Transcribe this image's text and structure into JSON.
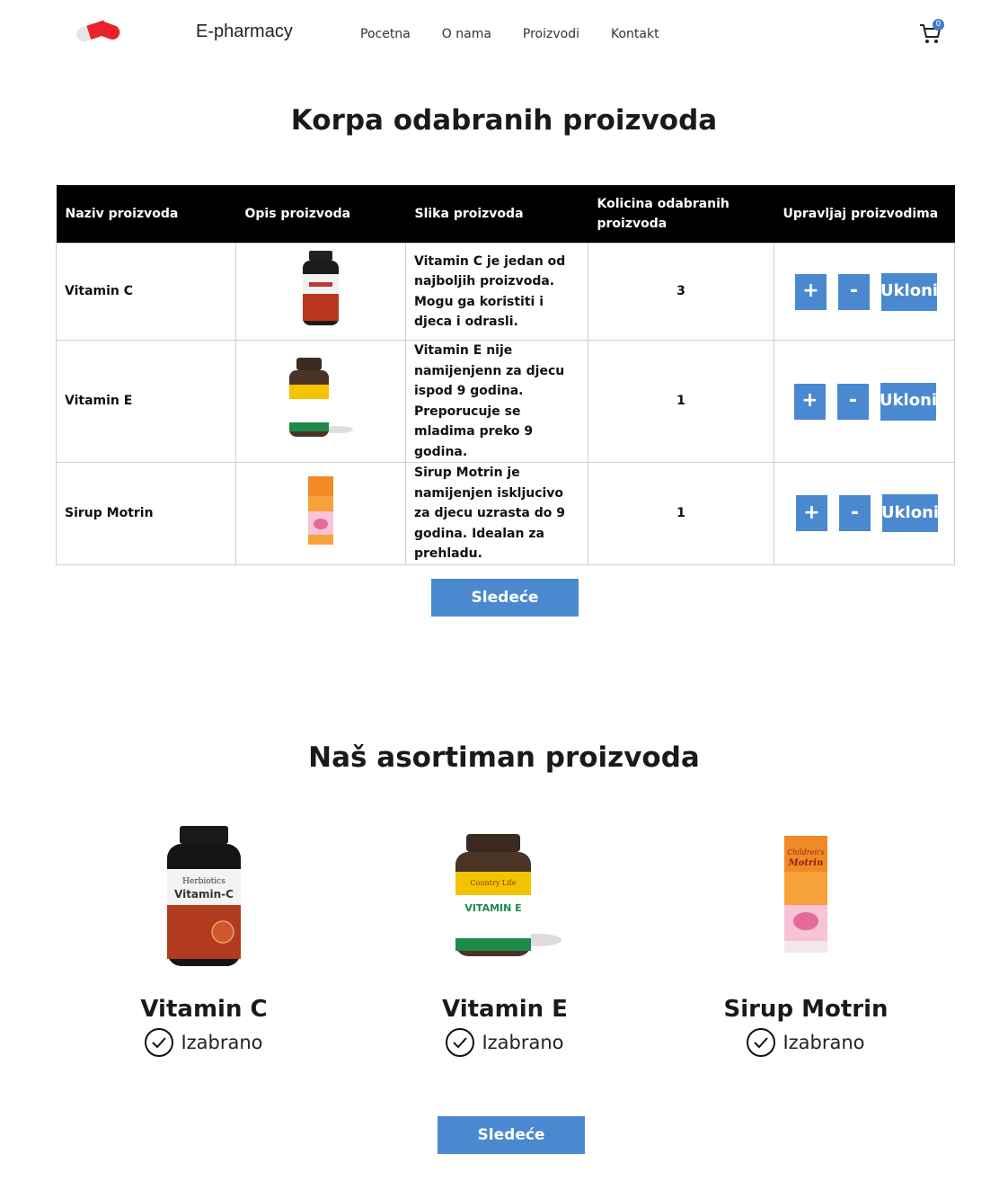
{
  "header": {
    "brand": "E-pharmacy",
    "nav": [
      "Pocetna",
      "O nama",
      "Proizvodi",
      "Kontakt"
    ],
    "cart_count": "0"
  },
  "cart_section": {
    "title": "Korpa odabranih proizvoda",
    "columns": [
      "Naziv proizvoda",
      "Opis proizvoda",
      "Slika proizvoda",
      "Kolicina odabranih proizvoda",
      "Upravljaj proizvodima"
    ],
    "rows": [
      {
        "name": "Vitamin C",
        "description": "Vitamin C je jedan od najboljih proizvoda. Mogu ga koristiti i djeca i odrasli.",
        "quantity": "3",
        "plus": "+",
        "minus": "-",
        "remove": "Ukloni"
      },
      {
        "name": "Vitamin E",
        "description": "Vitamin E nije namijenjenn za djecu ispod 9 godina. Preporucuje se mladima preko 9 godina.",
        "quantity": "1",
        "plus": "+",
        "minus": "-",
        "remove": "Ukloni"
      },
      {
        "name": "Sirup Motrin",
        "description": "Sirup Motrin je namijenjen iskljucivo za djecu uzrasta do 9 godina. Idealan za prehladu.",
        "quantity": "1",
        "plus": "+",
        "minus": "-",
        "remove": "Ukloni"
      }
    ],
    "next_label": "Sledeće"
  },
  "products_section": {
    "title": "Naš asortiman proizvoda",
    "products": [
      {
        "name": "Vitamin C",
        "status": "Izabrano",
        "label_brand": "Herbiotics",
        "label_name": "Vitamin-C"
      },
      {
        "name": "Vitamin E",
        "status": "Izabrano",
        "label_brand": "Country Life",
        "label_name": "VITAMIN E"
      },
      {
        "name": "Sirup Motrin",
        "status": "Izabrano",
        "label_brand": "Children's",
        "label_name": "Motrin"
      }
    ],
    "next_label": "Sledeće"
  },
  "colors": {
    "accent": "#4a89cf",
    "header_bg": "#000000",
    "logo_red": "#e8232a"
  }
}
